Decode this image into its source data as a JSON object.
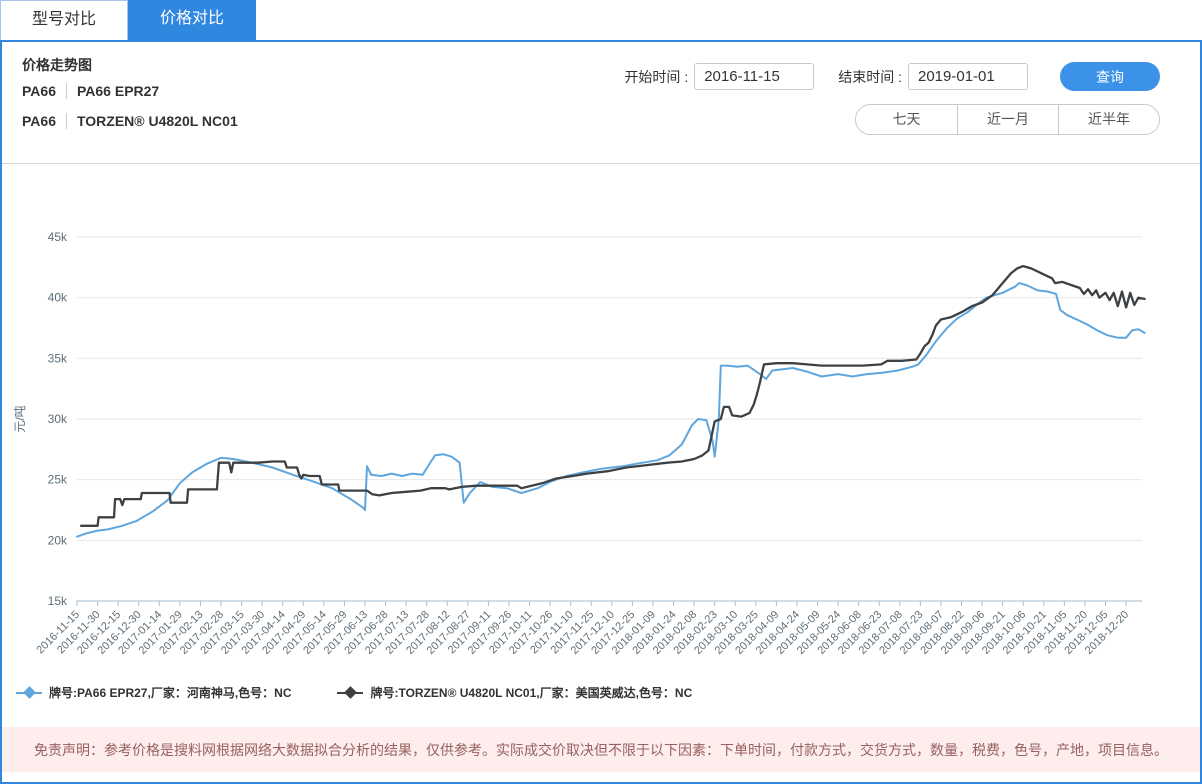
{
  "tabs": [
    {
      "label": "型号对比",
      "active": false
    },
    {
      "label": "价格对比",
      "active": true
    }
  ],
  "header": {
    "title": "价格走势图",
    "products": [
      {
        "category": "PA66",
        "name": "PA66 EPR27"
      },
      {
        "category": "PA66",
        "name": "TORZEN® U4820L NC01"
      }
    ],
    "start_label": "开始时间 :",
    "start_value": "2016-11-15",
    "end_label": "结束时间 :",
    "end_value": "2019-01-01",
    "query_label": "查询",
    "range_buttons": [
      "七天",
      "近一月",
      "近半年"
    ]
  },
  "colors": {
    "accent": "#2f87e0",
    "button": "#3b92e8",
    "grid": "#e7e7e7",
    "axis": "#a3bed4",
    "tick_text": "#5f6e78",
    "disclaimer_bg": "#fdeded",
    "disclaimer_text": "#996060"
  },
  "chart_data": {
    "type": "line",
    "ylabel": "元/吨",
    "unit": "k元/吨",
    "ylim": [
      15,
      45
    ],
    "grid": true,
    "legend_position": "bottom-left",
    "y_ticks": [
      "45k",
      "40k",
      "35k",
      "30k",
      "25k",
      "20k",
      "15k"
    ],
    "y_tick_values": [
      45,
      40,
      35,
      30,
      25,
      20,
      15
    ],
    "x_tick_labels": [
      "2016-11-15",
      "2016-11-30",
      "2016-12-15",
      "2016-12-30",
      "2017-01-14",
      "2017-01-29",
      "2017-02-13",
      "2017-02-28",
      "2017-03-15",
      "2017-03-30",
      "2017-04-14",
      "2017-04-29",
      "2017-05-14",
      "2017-05-29",
      "2017-06-13",
      "2017-06-28",
      "2017-07-13",
      "2017-07-28",
      "2017-08-12",
      "2017-08-27",
      "2017-09-11",
      "2017-09-26",
      "2017-10-11",
      "2017-10-26",
      "2017-11-10",
      "2017-11-25",
      "2017-12-10",
      "2017-12-25",
      "2018-01-09",
      "2018-01-24",
      "2018-02-08",
      "2018-02-23",
      "2018-03-10",
      "2018-03-25",
      "2018-04-09",
      "2018-04-24",
      "2018-05-09",
      "2018-05-24",
      "2018-06-08",
      "2018-06-23",
      "2018-07-08",
      "2018-07-23",
      "2018-08-07",
      "2018-08-22",
      "2018-09-06",
      "2018-09-21",
      "2018-10-06",
      "2018-10-21",
      "2018-11-05",
      "2018-11-20",
      "2018-12-05",
      "2018-12-20"
    ],
    "series": [
      {
        "name": "牌号:PA66 EPR27,厂家：河南神马,色号：NC",
        "color": "#5ea6dd",
        "width": 2,
        "points": [
          [
            0,
            20.3
          ],
          [
            0.5,
            20.6
          ],
          [
            1,
            20.8
          ],
          [
            1.5,
            20.9
          ],
          [
            2.2,
            21.2
          ],
          [
            2.9,
            21.6
          ],
          [
            3.7,
            22.4
          ],
          [
            4.4,
            23.3
          ],
          [
            5,
            24.7
          ],
          [
            5.6,
            25.6
          ],
          [
            6.3,
            26.3
          ],
          [
            7,
            26.8
          ],
          [
            7.6,
            26.7
          ],
          [
            8.5,
            26.4
          ],
          [
            9.5,
            26.0
          ],
          [
            10.5,
            25.4
          ],
          [
            11.4,
            24.9
          ],
          [
            12.4,
            24.3
          ],
          [
            13.3,
            23.4
          ],
          [
            13.9,
            22.7
          ],
          [
            14,
            22.5
          ],
          [
            14.1,
            26.1
          ],
          [
            14.3,
            25.4
          ],
          [
            14.8,
            25.3
          ],
          [
            15.3,
            25.5
          ],
          [
            15.8,
            25.3
          ],
          [
            16.3,
            25.5
          ],
          [
            16.8,
            25.4
          ],
          [
            17.1,
            26.2
          ],
          [
            17.4,
            27.0
          ],
          [
            17.8,
            27.1
          ],
          [
            18.2,
            26.9
          ],
          [
            18.6,
            26.4
          ],
          [
            18.8,
            23.1
          ],
          [
            19.1,
            23.9
          ],
          [
            19.6,
            24.8
          ],
          [
            20.2,
            24.4
          ],
          [
            20.9,
            24.3
          ],
          [
            21.6,
            23.9
          ],
          [
            22.4,
            24.3
          ],
          [
            23.1,
            24.9
          ],
          [
            23.8,
            25.3
          ],
          [
            24.6,
            25.6
          ],
          [
            25.5,
            25.9
          ],
          [
            26.5,
            26.1
          ],
          [
            27.5,
            26.4
          ],
          [
            28.2,
            26.6
          ],
          [
            28.8,
            27.0
          ],
          [
            29.4,
            27.9
          ],
          [
            29.9,
            29.5
          ],
          [
            30.2,
            30.0
          ],
          [
            30.6,
            29.9
          ],
          [
            30.9,
            28.2
          ],
          [
            31,
            26.9
          ],
          [
            31.2,
            30.0
          ],
          [
            31.3,
            34.4
          ],
          [
            31.6,
            34.4
          ],
          [
            32.1,
            34.3
          ],
          [
            32.6,
            34.4
          ],
          [
            33.2,
            33.7
          ],
          [
            33.5,
            33.3
          ],
          [
            33.8,
            34.0
          ],
          [
            34.3,
            34.1
          ],
          [
            34.8,
            34.2
          ],
          [
            35.5,
            33.9
          ],
          [
            36.2,
            33.5
          ],
          [
            37,
            33.7
          ],
          [
            37.7,
            33.5
          ],
          [
            38.4,
            33.7
          ],
          [
            39.1,
            33.8
          ],
          [
            39.9,
            34.0
          ],
          [
            40.6,
            34.3
          ],
          [
            40.9,
            34.5
          ],
          [
            41.3,
            35.3
          ],
          [
            41.8,
            36.5
          ],
          [
            42.3,
            37.5
          ],
          [
            42.8,
            38.3
          ],
          [
            43.3,
            38.8
          ],
          [
            43.8,
            39.5
          ],
          [
            44.2,
            40.0
          ],
          [
            45,
            40.4
          ],
          [
            45.6,
            40.9
          ],
          [
            45.8,
            41.2
          ],
          [
            46.2,
            41.0
          ],
          [
            46.7,
            40.6
          ],
          [
            47.2,
            40.5
          ],
          [
            47.6,
            40.3
          ],
          [
            47.8,
            39.0
          ],
          [
            48.1,
            38.6
          ],
          [
            48.6,
            38.2
          ],
          [
            49.1,
            37.8
          ],
          [
            49.6,
            37.3
          ],
          [
            50.1,
            36.9
          ],
          [
            50.6,
            36.7
          ],
          [
            51,
            36.7
          ],
          [
            51.3,
            37.3
          ],
          [
            51.6,
            37.4
          ],
          [
            51.9,
            37.1
          ]
        ]
      },
      {
        "name": "牌号:TORZEN® U4820L NC01,厂家：美国英威达,色号：NC",
        "color": "#3d4144",
        "width": 2.3,
        "points": [
          [
            0.2,
            21.2
          ],
          [
            1,
            21.2
          ],
          [
            1.05,
            21.9
          ],
          [
            1.8,
            21.9
          ],
          [
            1.85,
            23.4
          ],
          [
            2.1,
            23.4
          ],
          [
            2.2,
            22.9
          ],
          [
            2.3,
            23.4
          ],
          [
            3.1,
            23.4
          ],
          [
            3.15,
            23.9
          ],
          [
            4.5,
            23.9
          ],
          [
            4.55,
            23.1
          ],
          [
            5.35,
            23.1
          ],
          [
            5.4,
            24.2
          ],
          [
            6.8,
            24.2
          ],
          [
            6.9,
            26.4
          ],
          [
            7.4,
            26.4
          ],
          [
            7.5,
            25.6
          ],
          [
            7.6,
            26.4
          ],
          [
            8.8,
            26.4
          ],
          [
            9.5,
            26.5
          ],
          [
            10.1,
            26.5
          ],
          [
            10.2,
            26.0
          ],
          [
            10.7,
            26.0
          ],
          [
            10.8,
            25.4
          ],
          [
            10.9,
            25.1
          ],
          [
            11,
            25.4
          ],
          [
            11.3,
            25.3
          ],
          [
            11.8,
            25.3
          ],
          [
            11.9,
            24.6
          ],
          [
            12.7,
            24.6
          ],
          [
            12.75,
            24.1
          ],
          [
            14.1,
            24.1
          ],
          [
            14.35,
            23.8
          ],
          [
            14.7,
            23.7
          ],
          [
            15.3,
            23.9
          ],
          [
            16,
            24.0
          ],
          [
            16.7,
            24.1
          ],
          [
            17.2,
            24.3
          ],
          [
            17.9,
            24.3
          ],
          [
            18.1,
            24.2
          ],
          [
            18.7,
            24.4
          ],
          [
            19.4,
            24.5
          ],
          [
            20.2,
            24.5
          ],
          [
            21.4,
            24.5
          ],
          [
            21.6,
            24.3
          ],
          [
            22.1,
            24.5
          ],
          [
            22.6,
            24.7
          ],
          [
            23.3,
            25.1
          ],
          [
            24.1,
            25.3
          ],
          [
            24.8,
            25.5
          ],
          [
            25.8,
            25.7
          ],
          [
            26.7,
            26.0
          ],
          [
            27.7,
            26.2
          ],
          [
            28.7,
            26.4
          ],
          [
            29.4,
            26.5
          ],
          [
            30,
            26.7
          ],
          [
            30.4,
            27.0
          ],
          [
            30.7,
            27.4
          ],
          [
            31,
            29.8
          ],
          [
            31.3,
            30.0
          ],
          [
            31.45,
            31.0
          ],
          [
            31.7,
            31.0
          ],
          [
            31.85,
            30.3
          ],
          [
            32.3,
            30.2
          ],
          [
            32.7,
            30.5
          ],
          [
            32.9,
            31.2
          ],
          [
            33.05,
            32.0
          ],
          [
            33.2,
            33.0
          ],
          [
            33.4,
            34.5
          ],
          [
            34,
            34.6
          ],
          [
            34.8,
            34.6
          ],
          [
            35.5,
            34.5
          ],
          [
            36.2,
            34.4
          ],
          [
            37.2,
            34.4
          ],
          [
            38.2,
            34.4
          ],
          [
            39.1,
            34.5
          ],
          [
            39.4,
            34.8
          ],
          [
            40.1,
            34.8
          ],
          [
            40.8,
            34.9
          ],
          [
            41,
            35.4
          ],
          [
            41.2,
            36.0
          ],
          [
            41.4,
            36.3
          ],
          [
            41.6,
            37.0
          ],
          [
            41.75,
            37.7
          ],
          [
            42,
            38.2
          ],
          [
            42.5,
            38.4
          ],
          [
            43,
            38.8
          ],
          [
            43.5,
            39.3
          ],
          [
            44,
            39.6
          ],
          [
            44.5,
            40.2
          ],
          [
            45,
            41.2
          ],
          [
            45.4,
            42.0
          ],
          [
            45.7,
            42.4
          ],
          [
            46,
            42.6
          ],
          [
            46.4,
            42.4
          ],
          [
            46.9,
            42.0
          ],
          [
            47.4,
            41.6
          ],
          [
            47.55,
            41.2
          ],
          [
            47.9,
            41.3
          ],
          [
            48.4,
            41.0
          ],
          [
            48.75,
            40.8
          ],
          [
            48.95,
            40.3
          ],
          [
            49.15,
            40.7
          ],
          [
            49.35,
            40.2
          ],
          [
            49.55,
            40.6
          ],
          [
            49.7,
            40.0
          ],
          [
            50,
            40.4
          ],
          [
            50.2,
            39.8
          ],
          [
            50.4,
            40.4
          ],
          [
            50.6,
            39.3
          ],
          [
            50.8,
            40.5
          ],
          [
            51,
            39.2
          ],
          [
            51.2,
            40.4
          ],
          [
            51.4,
            39.4
          ],
          [
            51.6,
            40.0
          ],
          [
            51.9,
            39.9
          ]
        ]
      }
    ]
  },
  "disclaimer": "免责声明：参考价格是搜料网根据网络大数据拟合分析的结果，仅供参考。实际成交价取决但不限于以下因素：下单时间，付款方式，交货方式，数量，税费，色号，产地，项目信息。"
}
